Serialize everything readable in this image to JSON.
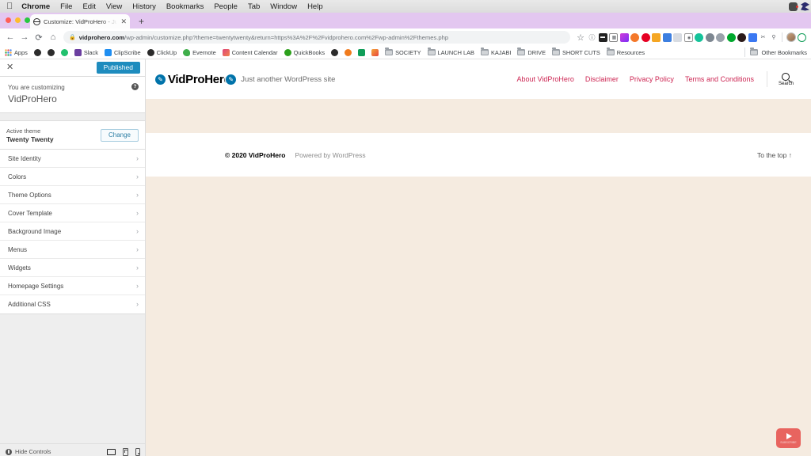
{
  "os_menubar": {
    "apple_icon": "apple-logo",
    "items": [
      {
        "label": "Chrome",
        "bold": true
      },
      {
        "label": "File",
        "bold": false
      },
      {
        "label": "Edit",
        "bold": false
      },
      {
        "label": "View",
        "bold": false
      },
      {
        "label": "History",
        "bold": false
      },
      {
        "label": "Bookmarks",
        "bold": false
      },
      {
        "label": "People",
        "bold": false
      },
      {
        "label": "Tab",
        "bold": false
      },
      {
        "label": "Window",
        "bold": false
      },
      {
        "label": "Help",
        "bold": false
      }
    ],
    "tray_icons": [
      "camera-icon",
      "dropbox-icon"
    ]
  },
  "browser": {
    "tab": {
      "title": "Customize: VidProHero - Just a",
      "favicon": "globe-icon",
      "close_icon": "close-icon"
    },
    "new_tab_label": "+",
    "nav": {
      "back_icon": "←",
      "forward_icon": "→",
      "reload_icon": "⟳",
      "home_icon": "⌂"
    },
    "omnibox": {
      "lock_icon": "lock-icon",
      "url_domain": "vidprohero.com",
      "url_path": "/wp-admin/customize.php?theme=twentytwenty&return=https%3A%2F%2Fvidprohero.com%2Fwp-admin%2Fthemes.php",
      "star_icon": "☆"
    },
    "extensions": [
      {
        "name": "info-icon",
        "color": "#ffffff",
        "glyph": "ⓘ"
      },
      {
        "name": "dark-reader-icon",
        "color": "#222222",
        "glyph": ""
      },
      {
        "name": "notes-icon",
        "color": "#ffffff",
        "glyph": "▤"
      },
      {
        "name": "bitwarden-icon",
        "color": "#cc33dd",
        "glyph": ""
      },
      {
        "name": "grammarly-icon",
        "color": "#f4782a",
        "glyph": ""
      },
      {
        "name": "pinterest-icon",
        "color": "#e60023",
        "glyph": ""
      },
      {
        "name": "screencast-icon",
        "color": "#f5a623",
        "glyph": ""
      },
      {
        "name": "eyedropper-icon",
        "color": "#3d7fe0",
        "glyph": ""
      },
      {
        "name": "tabs-icon",
        "color": "#d8dce2",
        "glyph": ""
      },
      {
        "name": "camera-icon",
        "color": "#ffffff",
        "glyph": "⌾"
      },
      {
        "name": "grammar-check-icon",
        "color": "#15c39a",
        "glyph": ""
      },
      {
        "name": "wordpress-icon",
        "color": "#7d8791",
        "glyph": ""
      },
      {
        "name": "globe-icon",
        "color": "#9aa2ab",
        "glyph": ""
      },
      {
        "name": "evernote-icon",
        "color": "#00a82d",
        "glyph": ""
      },
      {
        "name": "circle-dark-icon",
        "color": "#2b1a1a",
        "glyph": ""
      },
      {
        "name": "blue-square-icon",
        "color": "#3a78f2",
        "glyph": ""
      },
      {
        "name": "scissors-icon",
        "color": "#ffffff",
        "glyph": "✂"
      },
      {
        "name": "pin-icon",
        "color": "#ffffff",
        "glyph": "⚲"
      }
    ],
    "profile_avatar": "avatar",
    "profile_extra": "green-circle-icon",
    "bookmarks": [
      {
        "label": "Apps",
        "icon": "apps-grid-icon",
        "color": ""
      },
      {
        "label": "",
        "icon": "globe-icon",
        "color": "#2b2b2b"
      },
      {
        "label": "",
        "icon": "globe-icon",
        "color": "#2b2b2b"
      },
      {
        "label": "",
        "icon": "drive-icon",
        "color": "#21c06d"
      },
      {
        "label": "Slack",
        "icon": "slack-icon",
        "color": "#6b3fa0"
      },
      {
        "label": "ClipScribe",
        "icon": "clipscribe-icon",
        "color": "#1f8ef1"
      },
      {
        "label": "ClickUp",
        "icon": "clickup-icon",
        "color": "#2b2b2b"
      },
      {
        "label": "Evernote",
        "icon": "evernote-icon",
        "color": "#3fae4a"
      },
      {
        "label": "Content Calendar",
        "icon": "calendar-icon",
        "color": "#e0457b"
      },
      {
        "label": "QuickBooks",
        "icon": "quickbooks-icon",
        "color": "#2ca01c"
      },
      {
        "label": "",
        "icon": "globe-icon",
        "color": "#2b2b2b"
      },
      {
        "label": "",
        "icon": "orange-circle-icon",
        "color": "#f07b1d"
      },
      {
        "label": "",
        "icon": "sheets-icon",
        "color": "#0f9d58"
      },
      {
        "label": "",
        "icon": "analytics-icon",
        "color": "#f4a63a"
      },
      {
        "label": "SOCIETY",
        "icon": "folder-icon",
        "color": ""
      },
      {
        "label": "LAUNCH LAB",
        "icon": "folder-icon",
        "color": ""
      },
      {
        "label": "KAJABI",
        "icon": "folder-icon",
        "color": ""
      },
      {
        "label": "DRIVE",
        "icon": "folder-icon",
        "color": ""
      },
      {
        "label": "SHORT CUTS",
        "icon": "folder-icon",
        "color": ""
      },
      {
        "label": "Resources",
        "icon": "folder-icon",
        "color": ""
      }
    ],
    "other_bookmarks": {
      "label": "Other Bookmarks",
      "icon": "folder-icon"
    }
  },
  "customizer": {
    "close_icon": "close-icon",
    "publish_label": "Published",
    "customizing_label": "You are customizing",
    "site_name": "VidProHero",
    "help_icon": "help-icon",
    "active_theme_label": "Active theme",
    "active_theme_name": "Twenty Twenty",
    "change_label": "Change",
    "sections": [
      {
        "label": "Site Identity"
      },
      {
        "label": "Colors"
      },
      {
        "label": "Theme Options"
      },
      {
        "label": "Cover Template"
      },
      {
        "label": "Background Image"
      },
      {
        "label": "Menus"
      },
      {
        "label": "Widgets"
      },
      {
        "label": "Homepage Settings"
      },
      {
        "label": "Additional CSS"
      }
    ],
    "chevron_icon": "chevron-right-icon",
    "footer": {
      "hide_controls_label": "Hide Controls",
      "hide_icon": "hide-controls-icon",
      "devices": [
        {
          "name": "desktop-preview",
          "active": true
        },
        {
          "name": "tablet-preview",
          "active": false
        },
        {
          "name": "mobile-preview",
          "active": false
        }
      ]
    }
  },
  "preview": {
    "brand_name": "VidProHero",
    "tagline": "Just another WordPress site",
    "edit_icons": [
      "edit-pencil-logo",
      "edit-pencil-tagline"
    ],
    "nav_links": [
      {
        "label": "About VidProHero"
      },
      {
        "label": "Disclaimer"
      },
      {
        "label": "Privacy Policy"
      },
      {
        "label": "Terms and Conditions"
      }
    ],
    "search": {
      "label": "Search",
      "icon": "search-icon"
    },
    "footer": {
      "copyright": "© 2020 VidProHero",
      "powered_by": "Powered by WordPress",
      "to_top": "To the top ↑"
    },
    "colors": {
      "accent": "#cd2653",
      "background": "#f5ebe0",
      "publish_blue": "#1e8cbe"
    },
    "youtube_badge": {
      "icon": "youtube-play-icon",
      "label": "SUBSCRIBE"
    }
  }
}
